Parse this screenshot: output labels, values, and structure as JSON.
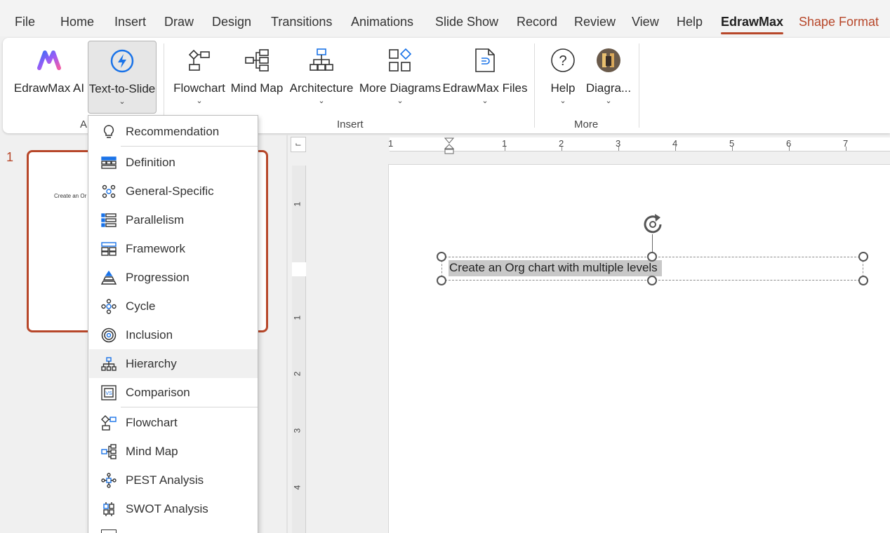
{
  "menu_tabs": {
    "file": "File",
    "home": "Home",
    "insert": "Insert",
    "draw": "Draw",
    "design": "Design",
    "transitions": "Transitions",
    "animations": "Animations",
    "slide_show": "Slide Show",
    "record": "Record",
    "review": "Review",
    "view": "View",
    "help": "Help",
    "edrawmax": "EdrawMax",
    "shape_format": "Shape Format"
  },
  "ribbon": {
    "ai_group_label": "A",
    "edrawmax_ai": "EdrawMax AI",
    "text_to_slide": "Text-to-Slide",
    "flowchart": "Flowchart",
    "mind_map": "Mind Map",
    "architecture": "Architecture",
    "more_diagrams": "More Diagrams",
    "edrawmax_files": "EdrawMax Files",
    "insert_group_label": "Insert",
    "help": "Help",
    "diagram": "Diagra...",
    "more_group_label": "More"
  },
  "dropdown": {
    "items": [
      {
        "label": "Recommendation",
        "icon": "lightbulb-icon"
      },
      {
        "label": "Definition",
        "icon": "definition-icon"
      },
      {
        "label": "General-Specific",
        "icon": "general-specific-icon"
      },
      {
        "label": "Parallelism",
        "icon": "parallelism-icon"
      },
      {
        "label": "Framework",
        "icon": "framework-icon"
      },
      {
        "label": "Progression",
        "icon": "progression-icon"
      },
      {
        "label": "Cycle",
        "icon": "cycle-icon"
      },
      {
        "label": "Inclusion",
        "icon": "inclusion-icon"
      },
      {
        "label": "Hierarchy",
        "icon": "hierarchy-icon"
      },
      {
        "label": "Comparison",
        "icon": "comparison-icon"
      },
      {
        "label": "Flowchart",
        "icon": "flowchart-icon"
      },
      {
        "label": "Mind Map",
        "icon": "mind-map-icon"
      },
      {
        "label": "PEST Analysis",
        "icon": "pest-icon"
      },
      {
        "label": "SWOT Analysis",
        "icon": "swot-icon"
      }
    ]
  },
  "slides": {
    "number": "1",
    "thumb_text": "Create an Or"
  },
  "ruler": {
    "h": [
      "1",
      "1",
      "2",
      "3",
      "4",
      "5",
      "6",
      "7"
    ],
    "v": [
      "1",
      "1",
      "2",
      "3",
      "4"
    ]
  },
  "canvas": {
    "text": "Create an Org chart with multiple levels"
  },
  "colors": {
    "accent": "#b7472a",
    "icon_blue": "#1a73e8"
  }
}
